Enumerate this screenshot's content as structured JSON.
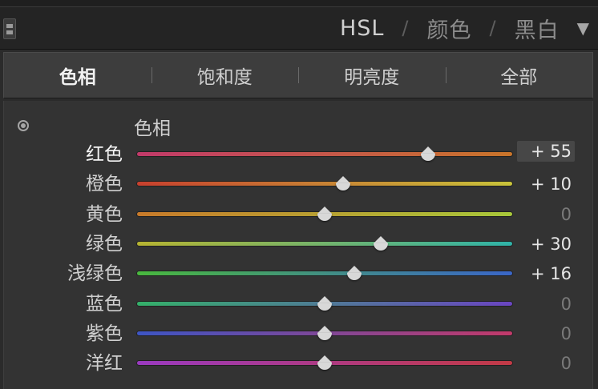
{
  "header": {
    "nav": [
      {
        "label": "HSL",
        "active": true
      },
      {
        "label": "颜色",
        "active": false
      },
      {
        "label": "黑白",
        "active": false
      }
    ],
    "separator": "/",
    "arrow": "▼"
  },
  "tabs": [
    {
      "label": "色相",
      "active": true
    },
    {
      "label": "饱和度",
      "active": false
    },
    {
      "label": "明亮度",
      "active": false
    },
    {
      "label": "全部",
      "active": false
    }
  ],
  "panel": {
    "title": "色相",
    "value_range": [
      -100,
      100
    ],
    "rows": [
      {
        "label": "红色",
        "value": 55,
        "display": "+ 55",
        "gradient": [
          "#c23a6a",
          "#c9752a"
        ]
      },
      {
        "label": "橙色",
        "value": 10,
        "display": "+ 10",
        "gradient": [
          "#c8402e",
          "#c9c43a"
        ]
      },
      {
        "label": "黄色",
        "value": 0,
        "display": "0",
        "gradient": [
          "#c87a2a",
          "#a8c83a"
        ]
      },
      {
        "label": "绿色",
        "value": 30,
        "display": "+ 30",
        "gradient": [
          "#b7b431",
          "#2fb3a8"
        ]
      },
      {
        "label": "浅绿色",
        "value": 16,
        "display": "+ 16",
        "gradient": [
          "#49b83e",
          "#3a66c8"
        ]
      },
      {
        "label": "蓝色",
        "value": 0,
        "display": "0",
        "gradient": [
          "#34b06a",
          "#6a45c2"
        ]
      },
      {
        "label": "紫色",
        "value": 0,
        "display": "0",
        "gradient": [
          "#3d55c4",
          "#c23a6a"
        ]
      },
      {
        "label": "洋红",
        "value": 0,
        "display": "0",
        "gradient": [
          "#9a3ac0",
          "#c23a45"
        ]
      }
    ]
  }
}
